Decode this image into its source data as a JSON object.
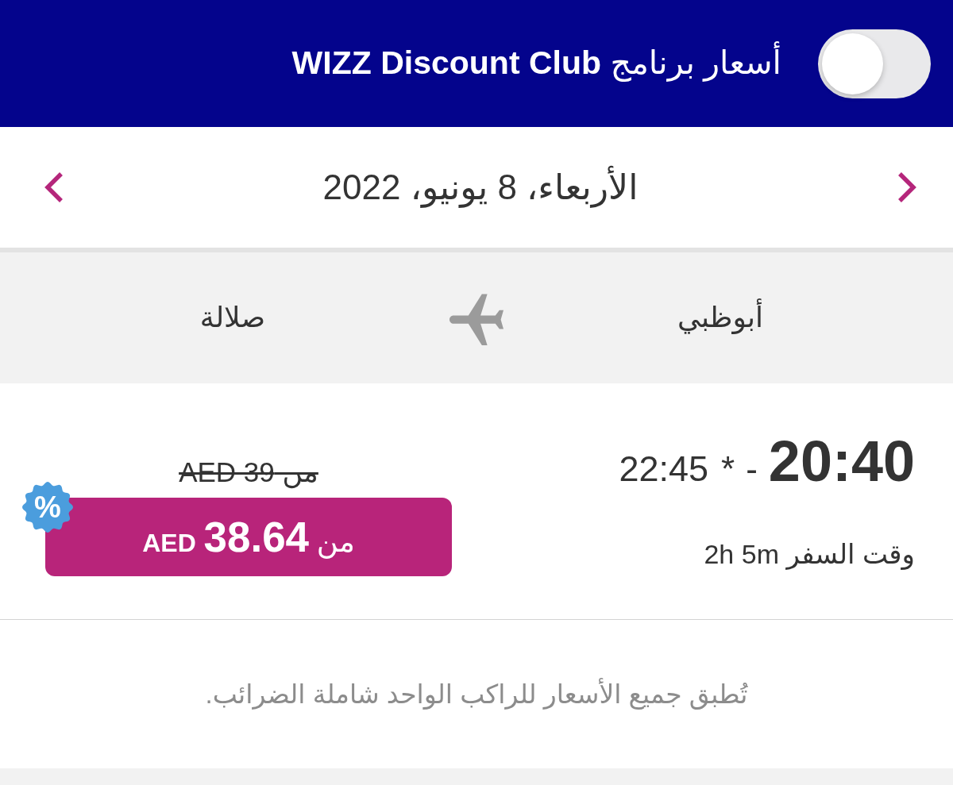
{
  "discount_club": {
    "label": "أسعار برنامج **WIZZ Discount Club**",
    "on": false
  },
  "date_bar": {
    "date": "الأربعاء، 8 يونيو، 2022"
  },
  "route": {
    "origin": "أبوظبي",
    "destination": "صلالة"
  },
  "flight": {
    "departure_time": "20:40",
    "separator": "-",
    "arrival_mark": "*",
    "arrival_time": "22:45",
    "duration": "وقت السفر 2h 5m",
    "old_price": "من AED 39",
    "price": {
      "prefix": "من",
      "amount": "38.64",
      "currency": "AED"
    },
    "badge": "%"
  },
  "note": "تُطبق جميع الأسعار للراكب الواحد شاملة الضرائب."
}
